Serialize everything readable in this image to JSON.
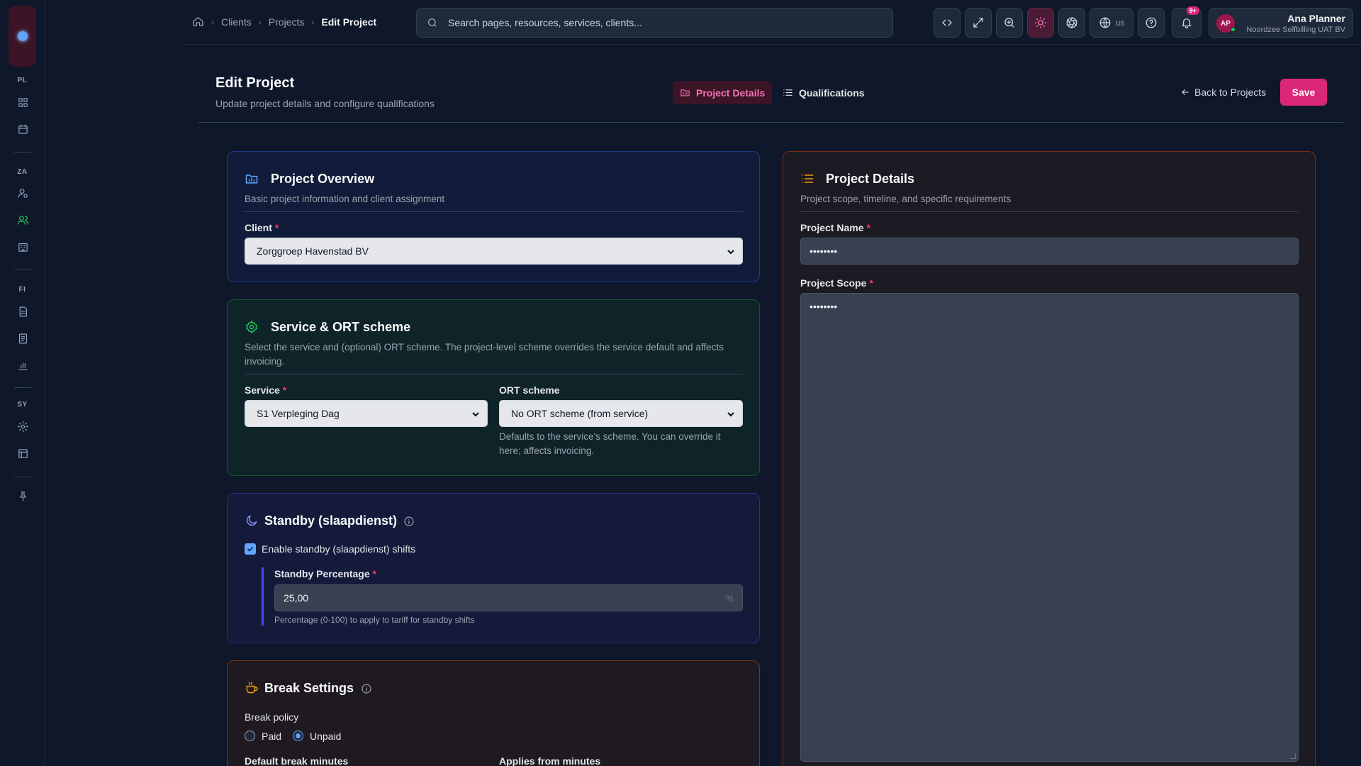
{
  "sidebar": {
    "sections": [
      "PL",
      "ZA",
      "FI",
      "SY"
    ],
    "icons": [
      "dashboard-icon",
      "calendar-icon",
      "user-settings-icon",
      "users-icon",
      "building-icon",
      "document-icon",
      "invoice-icon",
      "chart-icon",
      "gear-icon",
      "table-icon",
      "pin-icon"
    ]
  },
  "breadcrumb": {
    "items": [
      "Clients",
      "Projects"
    ],
    "current": "Edit Project"
  },
  "search": {
    "placeholder": "Search pages, resources, services, clients..."
  },
  "topbar": {
    "language": "us",
    "notifications_badge": "9+"
  },
  "user": {
    "initials": "AP",
    "name": "Ana Planner",
    "org": "Noordzee Selfbilling UAT BV"
  },
  "page": {
    "title": "Edit Project",
    "subtitle": "Update project details and configure qualifications",
    "tabs": [
      "Project Details",
      "Qualifications"
    ],
    "back_label": "Back to Projects",
    "save_label": "Save"
  },
  "overview": {
    "title": "Project Overview",
    "subtitle": "Basic project information and client assignment",
    "client_label": "Client",
    "client_value": "Zorggroep Havenstad BV"
  },
  "service": {
    "title": "Service & ORT scheme",
    "subtitle": "Select the service and (optional) ORT scheme. The project-level scheme overrides the service default and affects invoicing.",
    "service_label": "Service",
    "service_value": "S1 Verpleging Dag",
    "ort_label": "ORT scheme",
    "ort_value": "No ORT scheme (from service)",
    "ort_help": "Defaults to the service's scheme. You can override it here; affects invoicing."
  },
  "standby": {
    "title": "Standby (slaapdienst)",
    "checkbox_label": "Enable standby (slaapdienst) shifts",
    "checked": true,
    "pct_label": "Standby Percentage",
    "pct_value": "25,00",
    "pct_suffix": "%",
    "pct_help": "Percentage (0-100) to apply to tariff for standby shifts"
  },
  "breaks": {
    "title": "Break Settings",
    "policy_label": "Break policy",
    "options": [
      "Paid",
      "Unpaid"
    ],
    "selected": "Unpaid",
    "default_label": "Default break minutes",
    "applies_label": "Applies from minutes"
  },
  "details": {
    "title": "Project Details",
    "subtitle": "Project scope, timeline, and specific requirements",
    "name_label": "Project Name",
    "name_value": "••••••••",
    "scope_label": "Project Scope",
    "scope_value": "••••••••"
  },
  "colors": {
    "accent": "#db2777",
    "overview_border": "#1e3a8a",
    "service_border": "#14532d",
    "standby_border": "#312e81",
    "breaks_border": "#78350f",
    "details_border": "#7c2d12"
  }
}
